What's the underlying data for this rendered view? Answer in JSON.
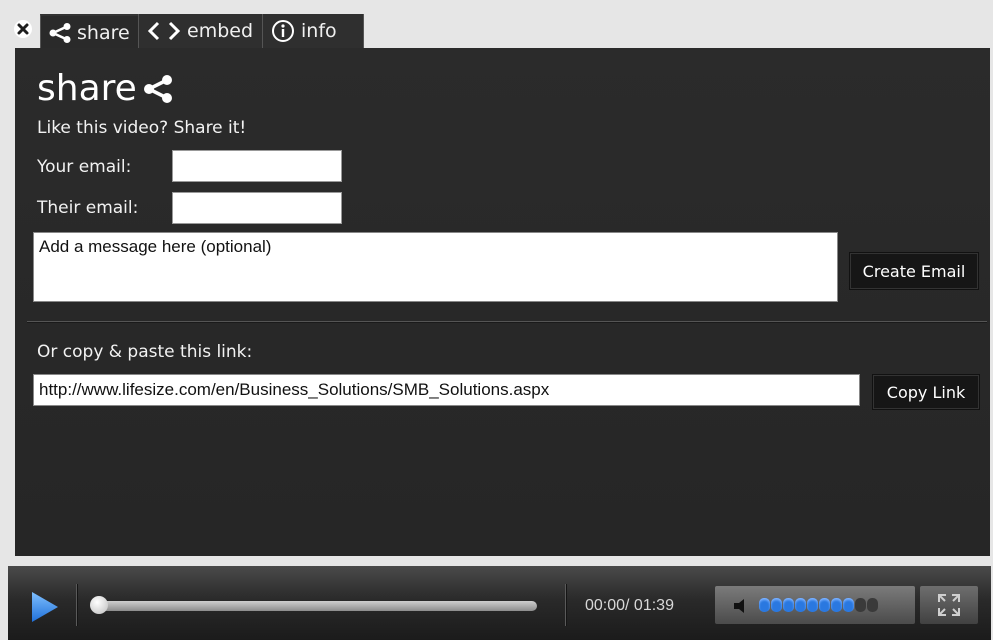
{
  "tabs": [
    {
      "label": "share",
      "icon": "share-icon"
    },
    {
      "label": "embed",
      "icon": "code-icon"
    },
    {
      "label": "info",
      "icon": "info-icon"
    }
  ],
  "share": {
    "title": "share",
    "subtitle": "Like this video? Share it!",
    "your_email_label": "Your email:",
    "their_email_label": "Their email:",
    "your_email_value": "",
    "their_email_value": "",
    "message_placeholder": "Add a message here (optional)",
    "create_email_label": "Create Email",
    "copy_label": "Or copy & paste this link:",
    "link_value": "http://www.lifesize.com/en/Business_Solutions/SMB_Solutions.aspx",
    "copy_link_label": "Copy Link"
  },
  "player": {
    "time": "00:00/ 01:39",
    "progress": 0.0,
    "volume_level": 0.8
  },
  "colors": {
    "panel_bg": "#272727",
    "accent_blue": "#2a78e0"
  }
}
